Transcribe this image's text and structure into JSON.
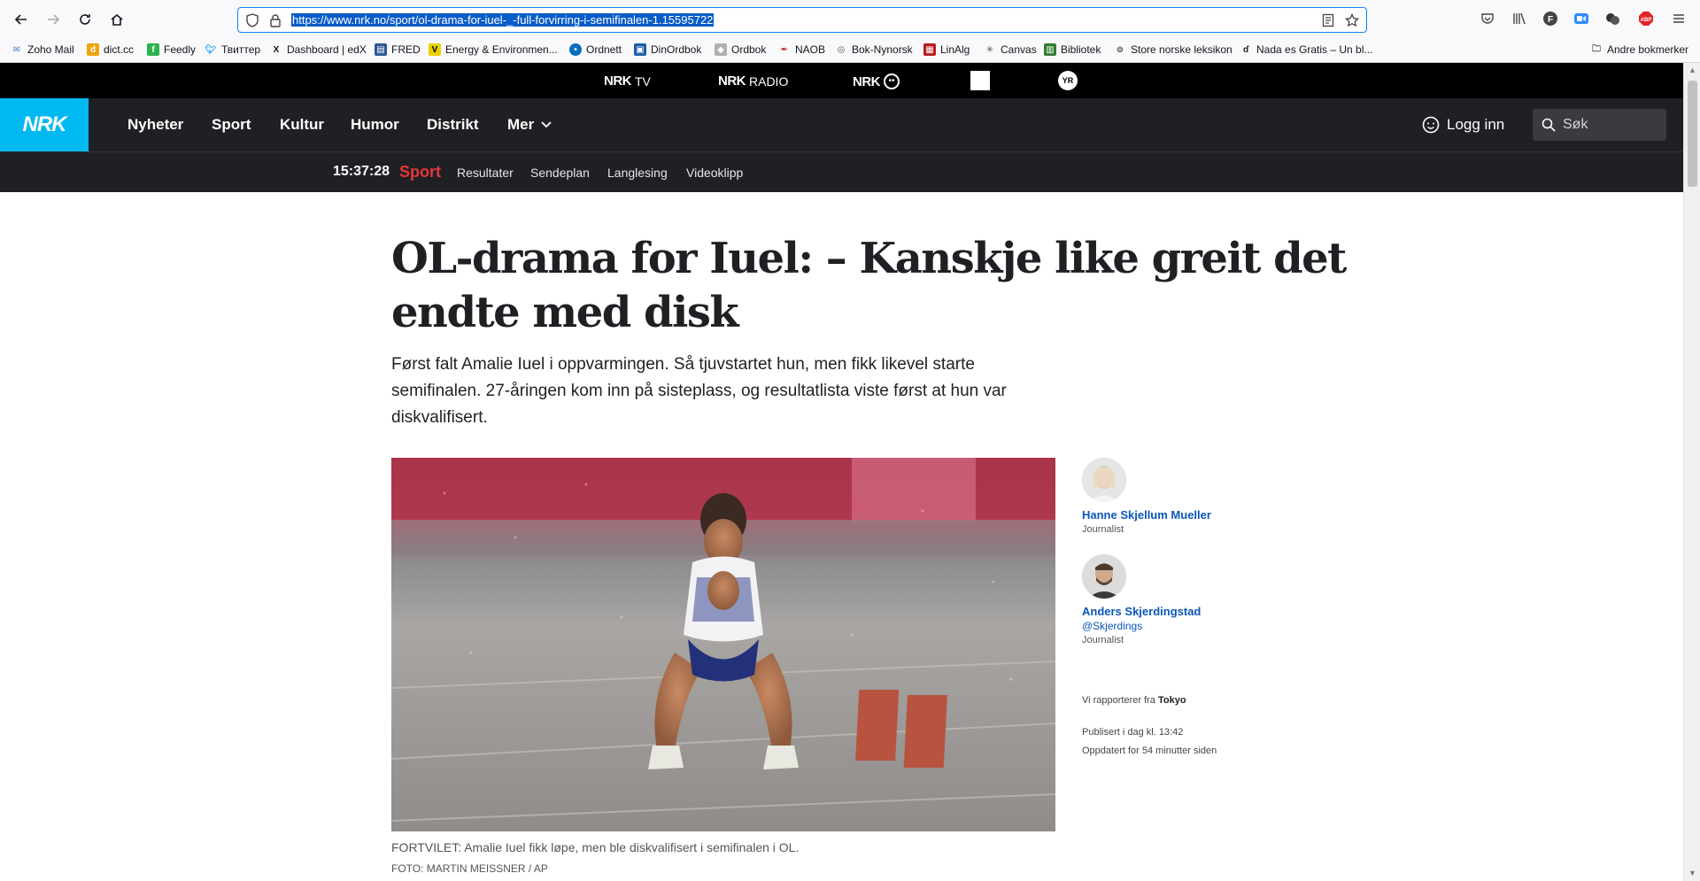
{
  "browser": {
    "url": "https://www.nrk.no/sport/ol-drama-for-iuel-_-full-forvirring-i-semifinalen-1.15595722",
    "bookmarks": [
      {
        "label": "Zoho Mail",
        "icon": "zoho-icon",
        "color": "#4a86c5"
      },
      {
        "label": "dict.cc",
        "icon": "dictcc-icon",
        "color": "#f0a30a"
      },
      {
        "label": "Feedly",
        "icon": "feedly-icon",
        "color": "#2bb24c"
      },
      {
        "label": "Твиттер",
        "icon": "twitter-icon",
        "color": "#1da1f2"
      },
      {
        "label": "Dashboard | edX",
        "icon": "edx-icon",
        "color": "#111111"
      },
      {
        "label": "FRED",
        "icon": "fred-icon",
        "color": "#2b5797"
      },
      {
        "label": "Energy & Environmen...",
        "icon": "energy-icon",
        "color": "#e8d000"
      },
      {
        "label": "Ordnett",
        "icon": "ordnett-icon",
        "color": "#0a6ebd"
      },
      {
        "label": "DinOrdbok",
        "icon": "dinordbok-icon",
        "color": "#1a5fa8"
      },
      {
        "label": "Ordbok",
        "icon": "ordbok-icon",
        "color": "#b0b0b0"
      },
      {
        "label": "NAOB",
        "icon": "naob-icon",
        "color": "#c62828"
      },
      {
        "label": "Bok-Nynorsk",
        "icon": "globe-icon",
        "color": "#666666"
      },
      {
        "label": "LinAlg",
        "icon": "linalg-icon",
        "color": "#b71c1c"
      },
      {
        "label": "Canvas",
        "icon": "canvas-icon",
        "color": "#555555"
      },
      {
        "label": "Bibliotek",
        "icon": "bibliotek-icon",
        "color": "#2e7d32"
      },
      {
        "label": "Store norske leksikon",
        "icon": "snl-icon",
        "color": "#555555"
      },
      {
        "label": "Nada es Gratis – Un bl...",
        "icon": "nada-icon",
        "color": "#222222"
      },
      {
        "label": "Andre bokmerker",
        "icon": "folder-icon",
        "color": "#555555"
      }
    ]
  },
  "strip": {
    "tv": "TV",
    "radio": "RADIO"
  },
  "header": {
    "logo": "NRK",
    "nav": [
      "Nyheter",
      "Sport",
      "Kultur",
      "Humor",
      "Distrikt",
      "Mer"
    ],
    "login": "Logg inn",
    "search_placeholder": "Søk"
  },
  "subheader": {
    "clock": "15:37:28",
    "section": "Sport",
    "links": [
      "Resultater",
      "Sendeplan",
      "Langlesing",
      "Videoklipp"
    ]
  },
  "article": {
    "headline": "OL-drama for Iuel: – Kanskje like greit det endte med disk",
    "lead": "Først falt Amalie Iuel i oppvarmingen. Så tjuvstartet hun, men fikk likevel starte semifinalen. 27-åringen kom inn på sisteplass, og resultatlista viste først at hun var diskvalifisert.",
    "caption": "FORTVILET: Amalie Iuel fikk løpe, men ble diskvalifisert i semifinalen i OL.",
    "credit": "FOTO: MARTIN MEISSNER / AP"
  },
  "authors": [
    {
      "name": "Hanne Skjellum Mueller",
      "handle": "",
      "role": "Journalist"
    },
    {
      "name": "Anders Skjerdingstad",
      "handle": "@Skjerdings",
      "role": "Journalist"
    }
  ],
  "meta": {
    "reporting_prefix": "Vi rapporterer fra",
    "reporting_place": "Tokyo",
    "published": "Publisert i dag kl. 13:42",
    "updated": "Oppdatert for 54 minutter siden"
  },
  "colors": {
    "nrk_blue": "#00b9f1",
    "header_dark": "#1f2024",
    "sport_red": "#e8353a",
    "link_blue": "#0b57b8"
  }
}
